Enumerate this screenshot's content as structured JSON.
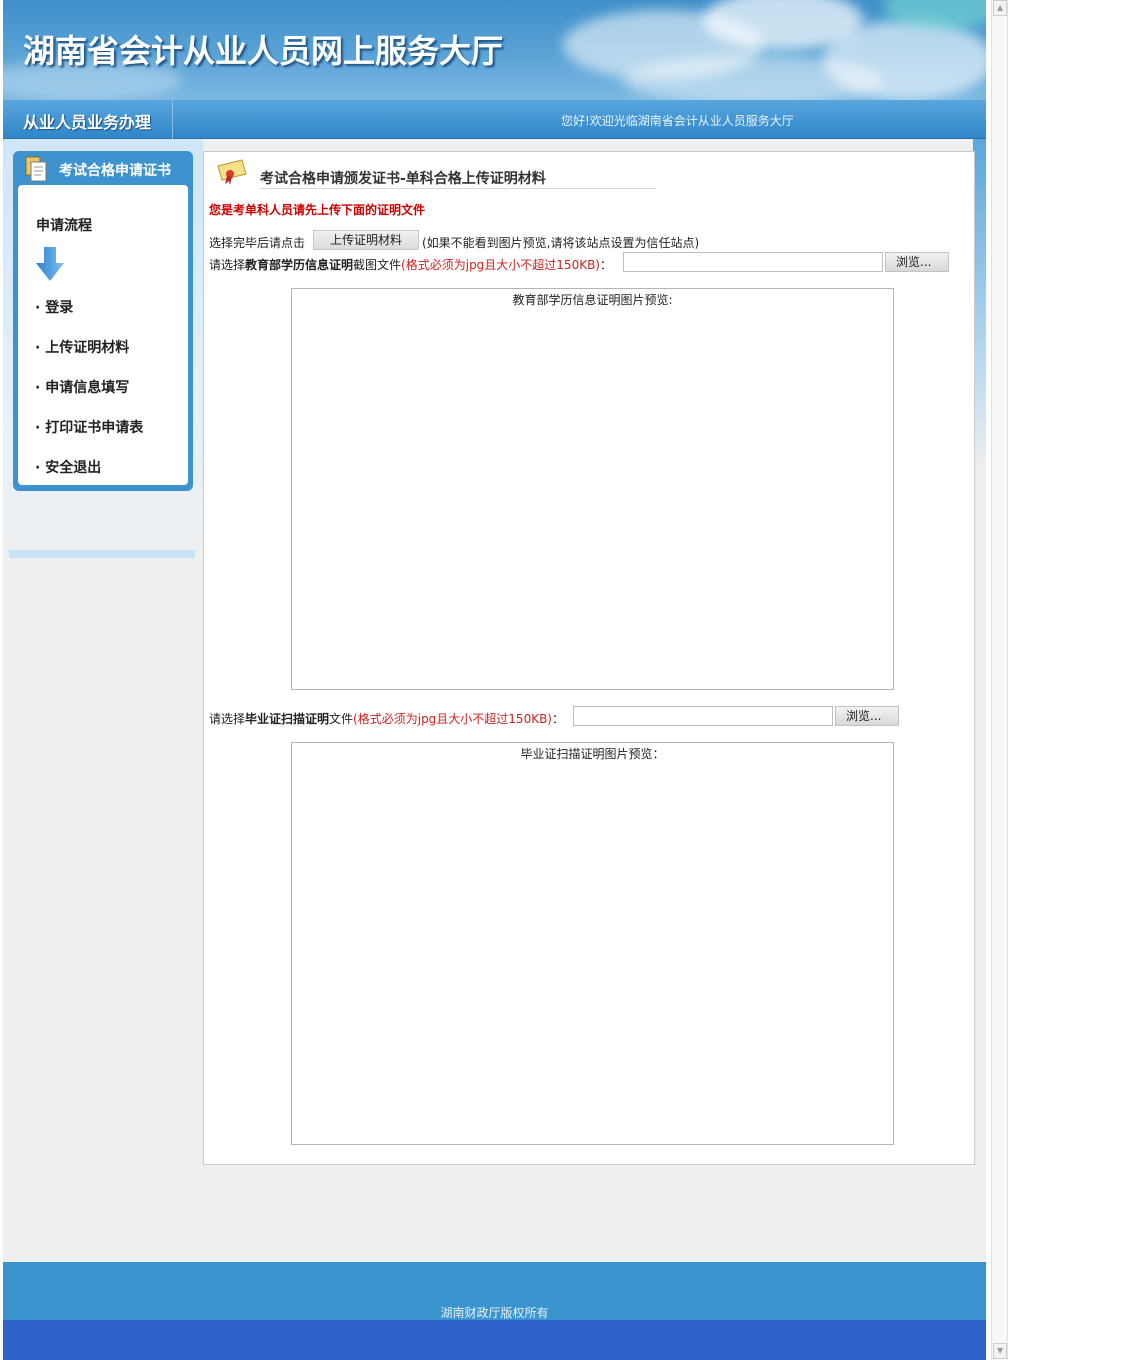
{
  "header": {
    "site_title": "湖南省会计从业人员网上服务大厅"
  },
  "navbar": {
    "section_title": "从业人员业务办理",
    "welcome": "您好!欢迎光临湖南省会计从业人员服务大厅"
  },
  "sidebar": {
    "title": "考试合格申请证书",
    "flow_title": "申请流程",
    "items": [
      {
        "label": "· 登录"
      },
      {
        "label": "· 上传证明材料"
      },
      {
        "label": "· 申请信息填写"
      },
      {
        "label": "· 打印证书申请表"
      },
      {
        "label": "· 安全退出"
      }
    ]
  },
  "main": {
    "title": "考试合格申请颁发证书-单科合格上传证明材料",
    "notice": "您是考单科人员请先上传下面的证明文件",
    "upload": {
      "label": "选择完毕后请点击",
      "button": "上传证明材料",
      "hint": "(如果不能看到图片预览,请将该站点设置为信任站点)"
    },
    "edu_file": {
      "prefix": "请选择",
      "bold": "教育部学历信息证明",
      "suffix": "截图文件",
      "requirement": "(格式必须为jpg且大小不超过150KB)",
      "colon": "：",
      "browse": "浏览...",
      "preview_caption": "教育部学历信息证明图片预览:"
    },
    "grad_file": {
      "prefix": "请选择",
      "bold": "毕业证扫描证明",
      "suffix": "文件",
      "requirement": "(格式必须为jpg且大小不超过150KB)",
      "colon": "：",
      "browse": "浏览...",
      "preview_caption": "毕业证扫描证明图片预览："
    }
  },
  "footer": {
    "copyright": "湖南财政厅版权所有"
  },
  "colors": {
    "brand_blue": "#3e93cf",
    "notice_red": "#cc0000",
    "requirement_red": "#cc2222",
    "footer_band": "#2f63c9"
  },
  "icons": {
    "sidebar": "documents-icon",
    "flow": "arrow-down-icon",
    "main": "certificate-icon"
  }
}
